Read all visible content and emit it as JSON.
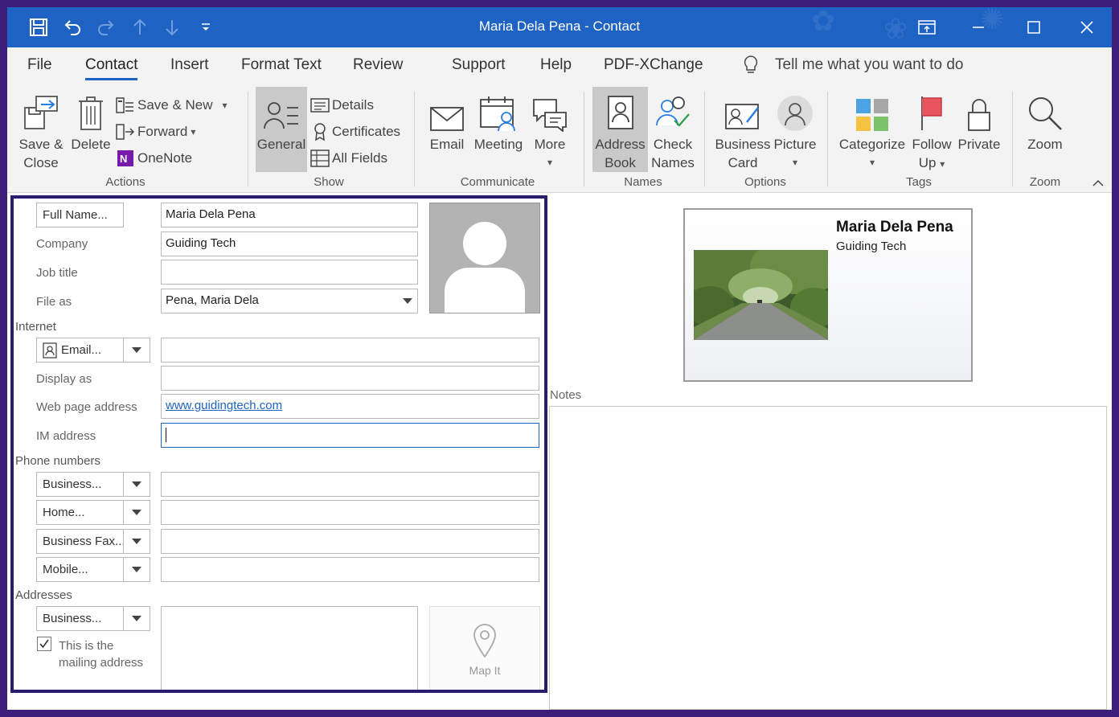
{
  "window": {
    "title": "Maria Dela Pena  -  Contact"
  },
  "menu": {
    "tabs": [
      "File",
      "Contact",
      "Insert",
      "Format Text",
      "Review",
      "Support",
      "Help",
      "PDF-XChange"
    ],
    "active": "Contact",
    "tell_me": "Tell me what you want to do"
  },
  "ribbon": {
    "actions": {
      "save_close": [
        "Save &",
        "Close"
      ],
      "delete": "Delete",
      "save_new": "Save & New",
      "forward": "Forward",
      "onenote": "OneNote",
      "label": "Actions"
    },
    "show": {
      "general": "General",
      "details": "Details",
      "certificates": "Certificates",
      "all_fields": "All Fields",
      "label": "Show"
    },
    "communicate": {
      "email": "Email",
      "meeting": "Meeting",
      "more": "More",
      "label": "Communicate"
    },
    "names": {
      "address_book": [
        "Address",
        "Book"
      ],
      "check_names": [
        "Check",
        "Names"
      ],
      "label": "Names"
    },
    "options": {
      "business_card": [
        "Business",
        "Card"
      ],
      "picture": "Picture",
      "label": "Options"
    },
    "tags": {
      "categorize": "Categorize",
      "follow_up": [
        "Follow",
        "Up"
      ],
      "private": "Private",
      "label": "Tags"
    },
    "zoom": {
      "zoom": "Zoom",
      "label": "Zoom"
    }
  },
  "form": {
    "full_name_btn": "Full Name...",
    "full_name": "Maria Dela Pena",
    "company_label": "Company",
    "company": "Guiding Tech",
    "job_title_label": "Job title",
    "job_title": "",
    "file_as_label": "File as",
    "file_as": "Pena, Maria Dela",
    "internet_section": "Internet",
    "email_btn": "Email...",
    "email": "",
    "display_as_label": "Display as",
    "display_as": "",
    "web_label": "Web page address",
    "web": "www.guidingtech.com",
    "im_label": "IM address",
    "im": "",
    "phone_section": "Phone numbers",
    "phones": [
      {
        "type": "Business...",
        "value": ""
      },
      {
        "type": "Home...",
        "value": ""
      },
      {
        "type": "Business Fax...",
        "value": ""
      },
      {
        "type": "Mobile...",
        "value": ""
      }
    ],
    "addresses_section": "Addresses",
    "address_type": "Business...",
    "address": "",
    "mailing_check": [
      "This is the",
      "mailing address"
    ],
    "mailing_checked": true,
    "map_it": "Map It"
  },
  "business_card": {
    "name": "Maria Dela Pena",
    "company": "Guiding Tech"
  },
  "notes": {
    "label": "Notes",
    "value": ""
  },
  "colors": {
    "title_bar": "#1e63c4",
    "accent": "#1e63c4",
    "form_outline": "#2b1c6e",
    "outer_frame": "#3b1d7a"
  }
}
